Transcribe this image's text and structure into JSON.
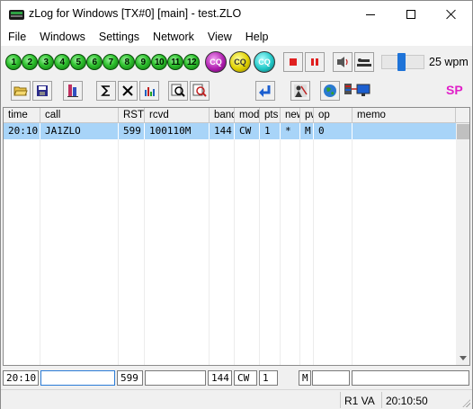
{
  "window": {
    "title": "zLog for Windows [TX#0] [main] - test.ZLO"
  },
  "menu": [
    "File",
    "Windows",
    "Settings",
    "Network",
    "View",
    "Help"
  ],
  "toolbar1": {
    "fkeys": [
      "1",
      "2",
      "3",
      "4",
      "5",
      "6",
      "7",
      "8",
      "9",
      "10",
      "11",
      "12"
    ],
    "cq_buttons": [
      "CQ",
      "CQ",
      "CQ"
    ],
    "speed_label": "25 wpm",
    "speed_level": 0.45,
    "icons": [
      "stop-icon",
      "pause-icon",
      "voice-icon",
      "cw-key-icon"
    ]
  },
  "toolbar2": {
    "icons": [
      "open-folder-icon",
      "save-disk-icon",
      "contest-stats-icon",
      "sum-icon",
      "multiplier-icon",
      "bar-chart-icon",
      "zoom-icon",
      "search-icon",
      "return-arrow-icon",
      "spot-icon",
      "globe-icon",
      "network-icon"
    ],
    "mode_badge": "SP"
  },
  "log": {
    "columns": [
      "time",
      "call",
      "RST",
      "rcvd",
      "band",
      "mod",
      "pts",
      "new",
      "pw",
      "op",
      "memo"
    ],
    "rows": [
      {
        "time": "20:10",
        "call": "JA1ZLO",
        "rst": "599",
        "rcvd": "100110M",
        "band": "144",
        "mode": "CW",
        "pts": "1",
        "new": "*",
        "pw": "M",
        "op": "0",
        "memo": ""
      }
    ]
  },
  "entry": {
    "time": "20:10",
    "call": "",
    "rst": "599",
    "rcvd": "",
    "band": "144",
    "mode": "CW",
    "pts": "1",
    "pw": "M",
    "op": "",
    "memo": ""
  },
  "status": {
    "rig": "R1 VA",
    "clock": "20:10:50"
  },
  "colors": {
    "selected_row": "#a8d4f8",
    "sp_badge": "#e020c8",
    "fkey": "#2fc22f",
    "speed_thumb": "#1e73d8"
  }
}
